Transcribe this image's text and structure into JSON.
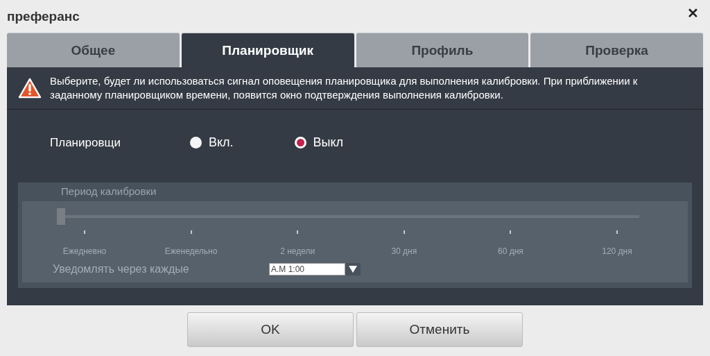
{
  "window": {
    "title": "преферанс",
    "close": "✕"
  },
  "tabs": [
    {
      "label": "Общее",
      "selected": false
    },
    {
      "label": "Планировщик",
      "selected": true
    },
    {
      "label": "Профиль",
      "selected": false
    },
    {
      "label": "Проверка",
      "selected": false
    }
  ],
  "warning": "Выберите, будет ли использоваться сигнал оповещения планировщика для выполнения калибровки. При приближении к заданному планировщиком времени, появится окно подтверждения выполнения калибровки.",
  "scheduler": {
    "label": "Планировщи",
    "options": [
      {
        "label": "Вкл.",
        "selected": false
      },
      {
        "label": "Выкл",
        "selected": true
      }
    ]
  },
  "calibration": {
    "title": "Период калибровки",
    "disabled": true,
    "slider": {
      "level": 0,
      "ticks": [
        "Ежедневно",
        "Еженедельно",
        "2 недели",
        "30 дня",
        "60 дня",
        "120 дня"
      ]
    },
    "notify_label": "Уведомлять через каждые",
    "notify_value": "A.M 1:00"
  },
  "buttons": [
    "OK",
    "Отменить"
  ]
}
